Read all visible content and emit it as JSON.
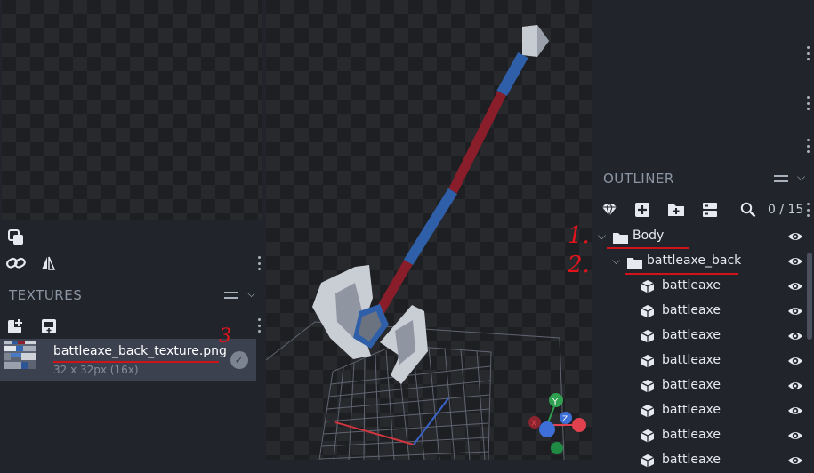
{
  "textures": {
    "title": "TEXTURES",
    "item": {
      "name": "battleaxe_back_texture.png",
      "size": "32 x 32px (16x)"
    }
  },
  "outliner": {
    "title": "OUTLINER",
    "count": "0 / 15",
    "groups": [
      {
        "label": "Body",
        "expanded": true
      },
      {
        "label": "battleaxe_back",
        "expanded": true
      }
    ],
    "cubes": [
      "battleaxe",
      "battleaxe",
      "battleaxe",
      "battleaxe",
      "battleaxe",
      "battleaxe",
      "battleaxe",
      "battleaxe"
    ]
  },
  "annotations": [
    "1.",
    "2.",
    "3"
  ],
  "gizmo": {
    "y": "Y",
    "x": "X",
    "z": "Z"
  },
  "colors": {
    "annotation": "#e1141c",
    "panel": "#21252b",
    "selected": "#3c4150",
    "axis_x": "#e1414e",
    "axis_y": "#2ea04f",
    "axis_z": "#3e6fd8"
  }
}
